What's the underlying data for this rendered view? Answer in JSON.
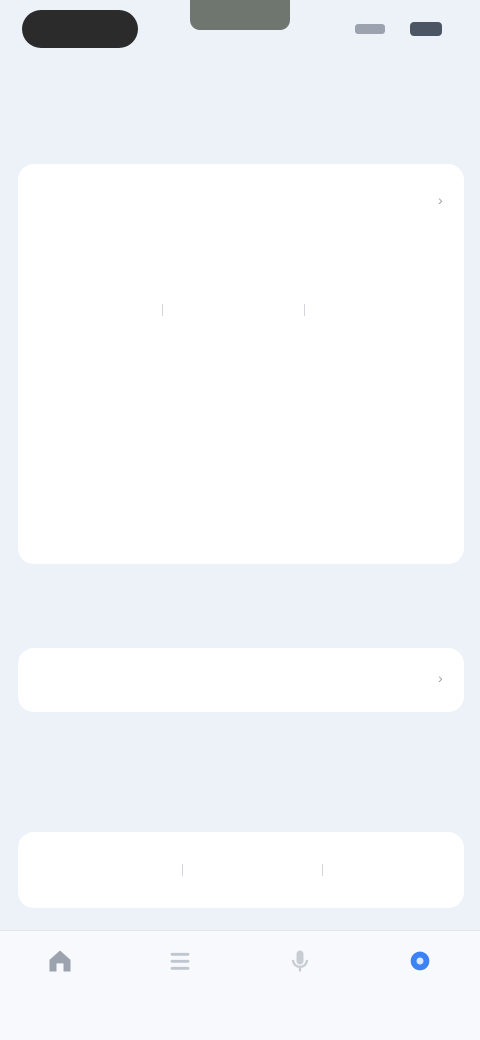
{
  "tabs": [
    {
      "label": ""
    },
    {
      "label": ""
    }
  ],
  "sections": {
    "first_title": "",
    "second_title": "",
    "third_title": ""
  },
  "card1": {
    "row1": {
      "label": "",
      "value": "",
      "value2": ""
    },
    "sub_label": "",
    "seg1": [
      "",
      "",
      ""
    ],
    "row2": {
      "label": "",
      "values": [
        "",
        "",
        ""
      ]
    },
    "row3": {
      "label": "",
      "values": [
        "",
        ""
      ]
    },
    "row4": {
      "label": "",
      "values": [
        "",
        ""
      ]
    }
  },
  "card2": {
    "row1": {
      "label": "",
      "value": ""
    }
  },
  "note": "",
  "card3": {
    "seg": [
      "",
      "",
      ""
    ]
  },
  "nav": [
    {
      "label": "",
      "icon": "home-icon"
    },
    {
      "label": "",
      "icon": "list-icon"
    },
    {
      "label": "",
      "icon": "mic-icon"
    },
    {
      "label": "",
      "icon": "settings-icon",
      "active": true
    }
  ],
  "colors": {
    "background": "#edf2f9",
    "card": "#ffffff",
    "accent": "#3b82f6"
  }
}
